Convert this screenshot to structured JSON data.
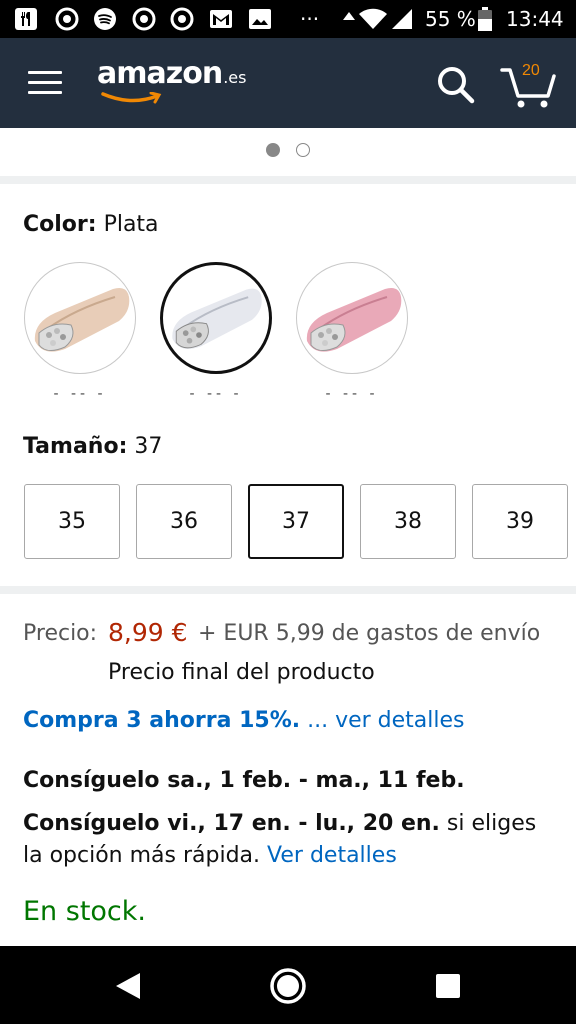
{
  "status_bar": {
    "battery_percent": "55 %",
    "time": "13:44",
    "more": "···",
    "icons": [
      "restaurant-icon",
      "chrome-icon",
      "spotify-icon",
      "chrome-icon",
      "chrome-icon",
      "gmail-icon",
      "image-icon",
      "signal-icon",
      "wifi-icon",
      "cell-signal-icon",
      "battery-icon"
    ]
  },
  "header": {
    "logo_word": "amazon",
    "logo_tld": ".es",
    "cart_count": "20",
    "background": "#232f3e",
    "accent": "#f08804"
  },
  "carousel": {
    "active_index": 0,
    "total": 2
  },
  "color": {
    "label": "Color:",
    "selected": "Plata",
    "options": [
      {
        "name": "gold-flat-shoe",
        "price": "- -- -"
      },
      {
        "name": "silver-flat-shoe",
        "price": "- -- -"
      },
      {
        "name": "pink-flat-shoe",
        "price": "- -- -"
      }
    ],
    "selected_index": 1
  },
  "size": {
    "label": "Tamaño:",
    "selected": "37",
    "options": [
      "35",
      "36",
      "37",
      "38",
      "39"
    ]
  },
  "price": {
    "label": "Precio:",
    "value": "8,99 €",
    "shipping": "+ EUR 5,99 de gastos de envío",
    "final": "Precio final del producto",
    "color": "#b12704"
  },
  "promo": {
    "bold": "Compra 3 ahorra 15%.",
    "link": "... ver detalles"
  },
  "delivery": {
    "standard": "Consíguelo sa., 1 feb. - ma., 11 feb.",
    "fast_bold": "Consíguelo vi., 17 en. - lu., 20 en.",
    "fast_rest": " si eliges la opción más rápida.",
    "fast_link": "Ver detalles"
  },
  "stock": {
    "text": "En stock.",
    "color": "#007600"
  },
  "navbar": {
    "buttons": [
      "back-icon",
      "home-icon",
      "recents-icon"
    ]
  }
}
